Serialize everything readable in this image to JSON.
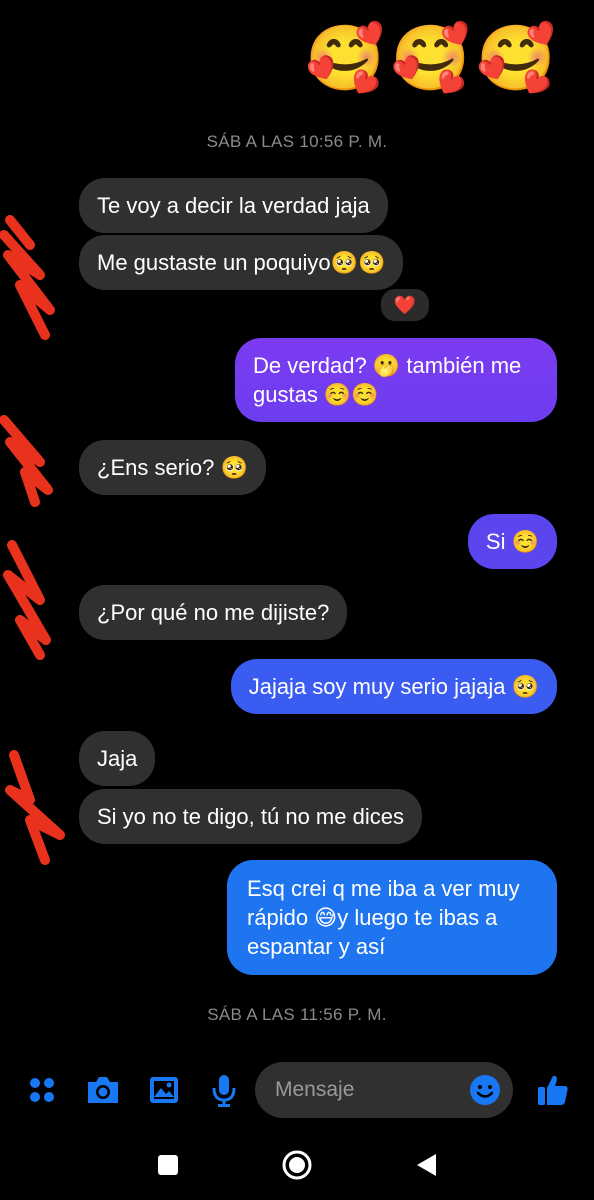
{
  "header_emojis": [
    "🥰",
    "🥰",
    "🥰"
  ],
  "timestamps": [
    "SÁB A LAS 10:56 P. M.",
    "SÁB A LAS 11:56 P. M."
  ],
  "messages": [
    {
      "from": "them",
      "text": "Te voy a decir la verdad jaja"
    },
    {
      "from": "them",
      "text": "Me gustaste un poquiyo🥺🥺"
    },
    {
      "from": "me",
      "text": "De verdad? 🫢 también me gustas ☺️☺️"
    },
    {
      "from": "them",
      "text": "¿Ens serio? 🥺"
    },
    {
      "from": "me",
      "text": "Si ☺️"
    },
    {
      "from": "them",
      "text": "¿Por qué no me dijiste?"
    },
    {
      "from": "me",
      "text": "Jajaja soy muy serio jajaja 🥺"
    },
    {
      "from": "them",
      "text": "Jaja"
    },
    {
      "from": "them",
      "text": "Si yo no te digo, tú no me dices"
    },
    {
      "from": "me",
      "text": "Esq crei q me iba a ver muy rápido 😅y luego te ibas a espantar y así"
    }
  ],
  "reaction": "❤️",
  "composer": {
    "placeholder": "Mensaje",
    "icons": [
      "menu-dots-icon",
      "camera-icon",
      "gallery-icon",
      "microphone-icon",
      "emoji-icon",
      "thumbs-up-icon"
    ]
  },
  "nav_icons": [
    "recents-icon",
    "home-icon",
    "back-icon"
  ],
  "colors": {
    "background": "#000000",
    "incoming_bubble": "#303030",
    "outgoing_purple": "#7b3df0",
    "outgoing_blue": "#1f74f0",
    "accent": "#1877f2",
    "timestamp": "#8a8a8d",
    "redaction": "#e8321e"
  }
}
